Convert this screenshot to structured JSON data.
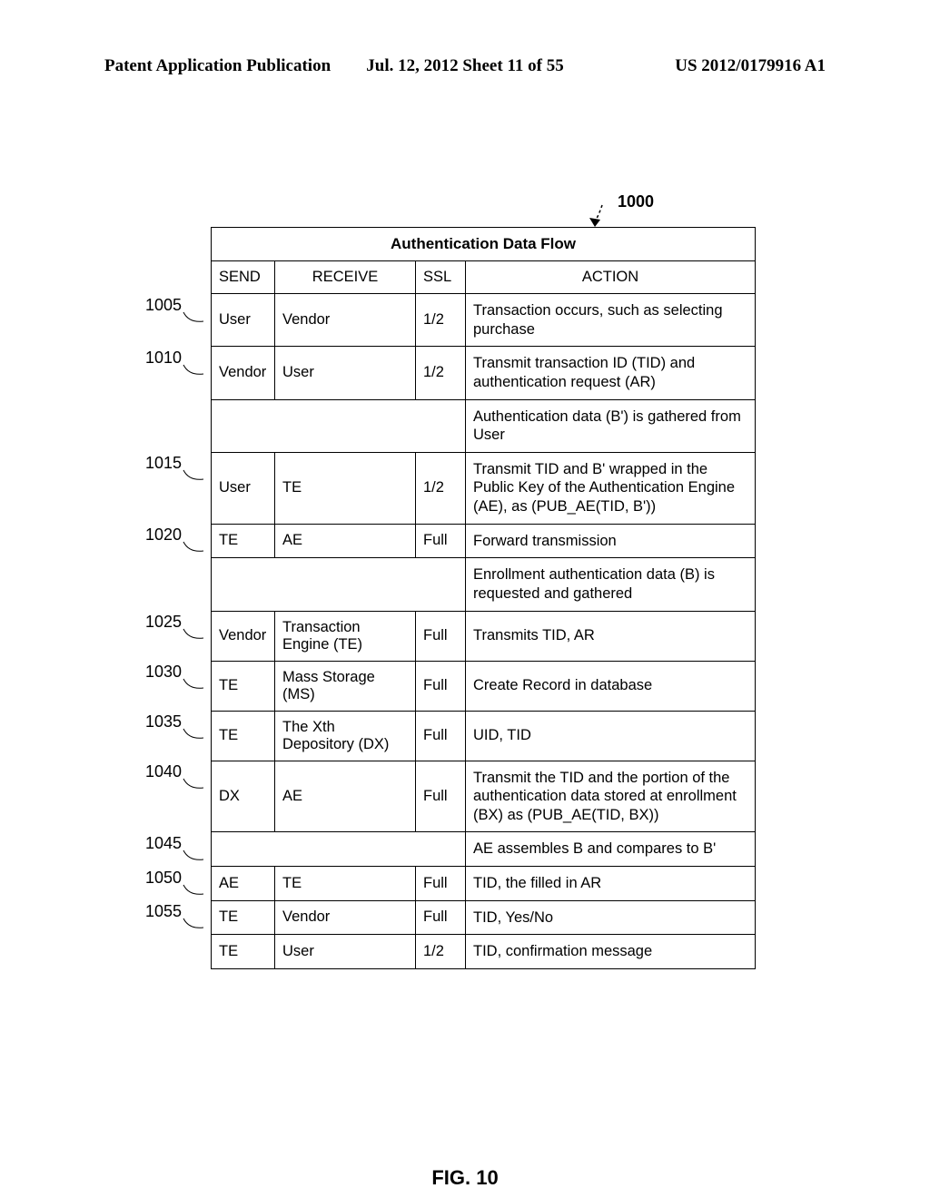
{
  "header": {
    "left": "Patent Application Publication",
    "center": "Jul. 12, 2012  Sheet 11 of 55",
    "right": "US 2012/0179916 A1"
  },
  "figure": {
    "ref_number": "1000",
    "caption": "FIG. 10",
    "table_title": "Authentication Data Flow",
    "columns": {
      "send": "SEND",
      "receive": "RECEIVE",
      "ssl": "SSL",
      "action": "ACTION"
    },
    "rows": [
      {
        "callout": "1005",
        "send": "User",
        "receive": "Vendor",
        "ssl": "1/2",
        "action": "Transaction occurs, such as selecting purchase"
      },
      {
        "callout": "1010",
        "send": "Vendor",
        "receive": "User",
        "ssl": "1/2",
        "action": "Transmit transaction ID (TID) and authentication request (AR)"
      },
      {
        "callout": "",
        "send": "",
        "receive": "",
        "ssl": "",
        "action": "Authentication data (B') is gathered from User",
        "merged": true
      },
      {
        "callout": "1015",
        "send": "User",
        "receive": "TE",
        "ssl": "1/2",
        "action": "Transmit TID and B' wrapped in the Public Key of the Authentication Engine (AE), as (PUB_AE(TID, B'))"
      },
      {
        "callout": "1020",
        "send": "TE",
        "receive": "AE",
        "ssl": "Full",
        "action": "Forward transmission"
      },
      {
        "callout": "",
        "send": "",
        "receive": "",
        "ssl": "",
        "action": "Enrollment authentication data (B) is requested and gathered",
        "merged": true
      },
      {
        "callout": "1025",
        "send": "Vendor",
        "receive": "Transaction Engine (TE)",
        "ssl": "Full",
        "action": "Transmits TID, AR"
      },
      {
        "callout": "1030",
        "send": "TE",
        "receive": "Mass Storage (MS)",
        "ssl": "Full",
        "action": "Create Record in database"
      },
      {
        "callout": "1035",
        "send": "TE",
        "receive": "The Xth Depository (DX)",
        "ssl": "Full",
        "action": "UID, TID"
      },
      {
        "callout": "1040",
        "send": "DX",
        "receive": "AE",
        "ssl": "Full",
        "action": "Transmit the TID and the portion of the authentication data stored at enrollment (BX) as (PUB_AE(TID, BX))"
      },
      {
        "callout": "1045",
        "send": "",
        "receive": "",
        "ssl": "",
        "action": "AE assembles B and compares to B'",
        "merged": true
      },
      {
        "callout": "1050",
        "send": "AE",
        "receive": "TE",
        "ssl": "Full",
        "action": "TID, the filled in AR"
      },
      {
        "callout": "1055",
        "send": "TE",
        "receive": "Vendor",
        "ssl": "Full",
        "action": "TID, Yes/No"
      },
      {
        "callout": "",
        "send": "TE",
        "receive": "User",
        "ssl": "1/2",
        "action": "TID, confirmation message"
      }
    ]
  },
  "chart_data": {
    "type": "table",
    "title": "Authentication Data Flow",
    "columns": [
      "SEND",
      "RECEIVE",
      "SSL",
      "ACTION"
    ],
    "rows": [
      [
        "User",
        "Vendor",
        "1/2",
        "Transaction occurs, such as selecting purchase"
      ],
      [
        "Vendor",
        "User",
        "1/2",
        "Transmit transaction ID (TID) and authentication request (AR)"
      ],
      [
        "",
        "",
        "",
        "Authentication data (B') is gathered from User"
      ],
      [
        "User",
        "TE",
        "1/2",
        "Transmit TID and B' wrapped in the Public Key of the Authentication Engine (AE), as (PUB_AE(TID, B'))"
      ],
      [
        "TE",
        "AE",
        "Full",
        "Forward transmission"
      ],
      [
        "",
        "",
        "",
        "Enrollment authentication data (B) is requested and gathered"
      ],
      [
        "Vendor",
        "Transaction Engine (TE)",
        "Full",
        "Transmits TID, AR"
      ],
      [
        "TE",
        "Mass Storage (MS)",
        "Full",
        "Create Record in database"
      ],
      [
        "TE",
        "The Xth Depository (DX)",
        "Full",
        "UID, TID"
      ],
      [
        "DX",
        "AE",
        "Full",
        "Transmit the TID and the portion of the authentication data stored at enrollment (BX) as (PUB_AE(TID, BX))"
      ],
      [
        "",
        "",
        "",
        "AE assembles B and compares to B'"
      ],
      [
        "AE",
        "TE",
        "Full",
        "TID, the filled in AR"
      ],
      [
        "TE",
        "Vendor",
        "Full",
        "TID, Yes/No"
      ],
      [
        "TE",
        "User",
        "1/2",
        "TID, confirmation message"
      ]
    ]
  }
}
